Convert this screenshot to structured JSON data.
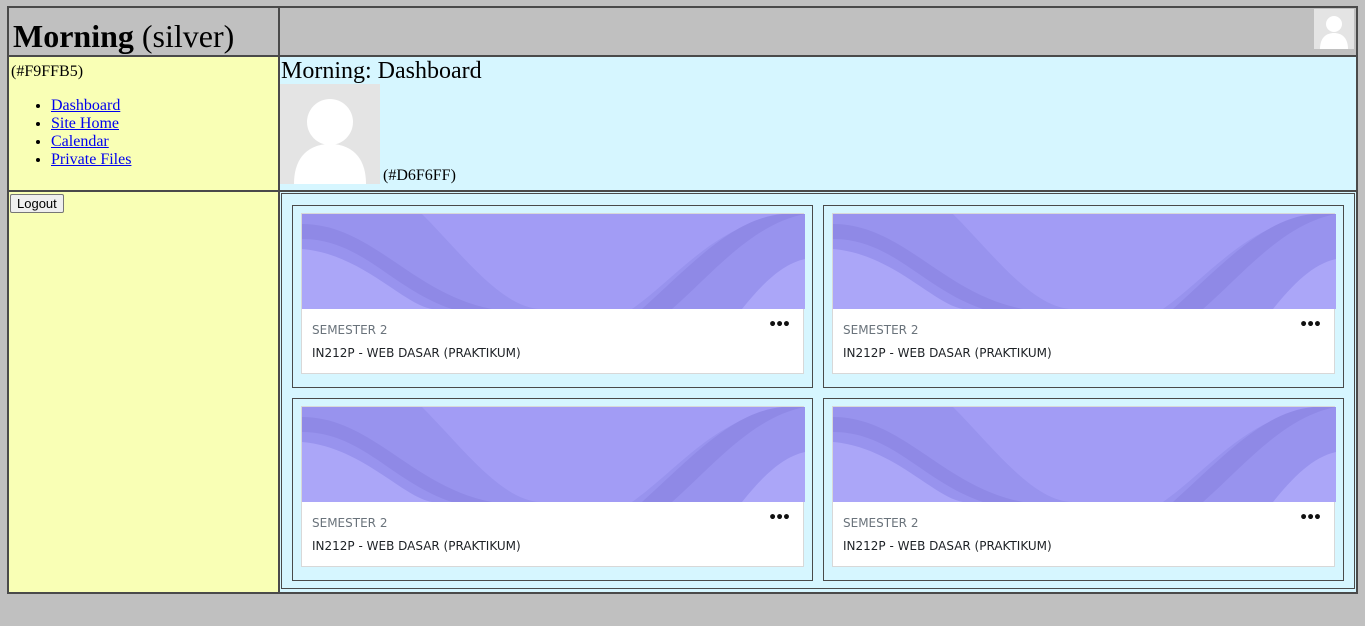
{
  "header": {
    "site_name": "Morning",
    "site_color_note": "(silver)"
  },
  "nav": {
    "color_note": "(#F9FFB5)",
    "items": [
      {
        "label": "Dashboard"
      },
      {
        "label": "Site Home"
      },
      {
        "label": "Calendar"
      },
      {
        "label": "Private Files"
      }
    ]
  },
  "dashboard": {
    "heading": "Morning: Dashboard",
    "color_note": "(#D6F6FF)"
  },
  "actions": {
    "logout_label": "Logout"
  },
  "courses": [
    {
      "category": "SEMESTER 2",
      "name": "IN212P - WEB DASAR (PRAKTIKUM)",
      "menu_label": "•••"
    },
    {
      "category": "SEMESTER 2",
      "name": "IN212P - WEB DASAR (PRAKTIKUM)",
      "menu_label": "•••"
    },
    {
      "category": "SEMESTER 2",
      "name": "IN212P - WEB DASAR (PRAKTIKUM)",
      "menu_label": "•••"
    },
    {
      "category": "SEMESTER 2",
      "name": "IN212P - WEB DASAR (PRAKTIKUM)",
      "menu_label": "•••"
    }
  ],
  "colors": {
    "page_bg": "#c0c0c0",
    "nav_bg": "#F9FFB5",
    "dashboard_bg": "#D6F6FF",
    "course_image_base": "#a29cf5",
    "course_image_wave": "#8f89e6"
  },
  "icons": {
    "user_avatar": "user-silhouette-icon",
    "course_menu": "more-horizontal-icon"
  }
}
